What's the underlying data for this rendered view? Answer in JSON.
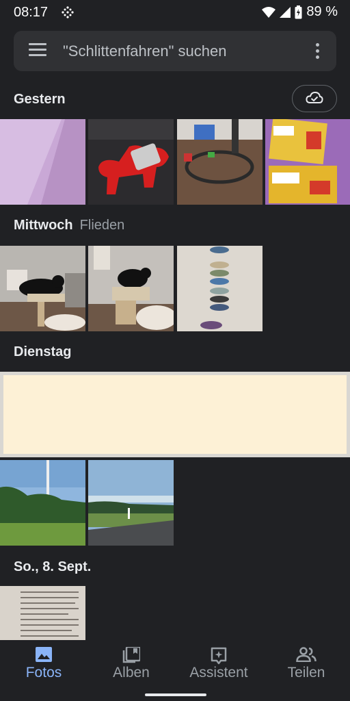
{
  "status": {
    "time": "08:17",
    "battery": "89 %"
  },
  "search": {
    "placeholder": "\"Schlittenfahren\" suchen"
  },
  "sections": [
    {
      "title": "Gestern",
      "subtitle": ""
    },
    {
      "title": "Mittwoch",
      "subtitle": "Flieden"
    },
    {
      "title": "Dienstag",
      "subtitle": ""
    },
    {
      "title": "So., 8. Sept.",
      "subtitle": ""
    }
  ],
  "nav": {
    "items": [
      {
        "label": "Fotos",
        "icon": "photo-icon"
      },
      {
        "label": "Alben",
        "icon": "album-icon"
      },
      {
        "label": "Assistent",
        "icon": "assistant-icon"
      },
      {
        "label": "Teilen",
        "icon": "people-icon"
      }
    ],
    "active": "Fotos"
  },
  "colors": {
    "accent": "#8ab4f8",
    "background": "#202124",
    "searchbar": "#303134"
  }
}
